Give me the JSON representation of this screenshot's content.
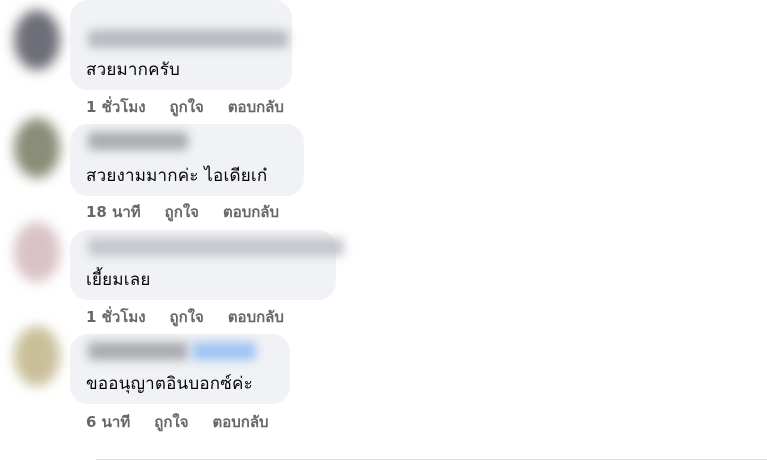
{
  "comments": [
    {
      "text": "สวยมากครับ",
      "time": "1 ชั่วโมง",
      "like": "ถูกใจ",
      "reply": "ตอบกลับ"
    },
    {
      "text": "สวยงามมากค่ะ ไอเดียเก๋",
      "time": "18 นาที",
      "like": "ถูกใจ",
      "reply": "ตอบกลับ"
    },
    {
      "text": "เยี้ยมเลย",
      "time": "1 ชั่วโมง",
      "like": "ถูกใจ",
      "reply": "ตอบกลับ"
    },
    {
      "text": "ขออนุญาตอินบอกซ์ค่ะ",
      "time": "6 นาที",
      "like": "ถูกใจ",
      "reply": "ตอบกลับ"
    }
  ],
  "colors": {
    "bubble": "#f0f2f5",
    "text": "#050505",
    "meta": "#65676b"
  }
}
